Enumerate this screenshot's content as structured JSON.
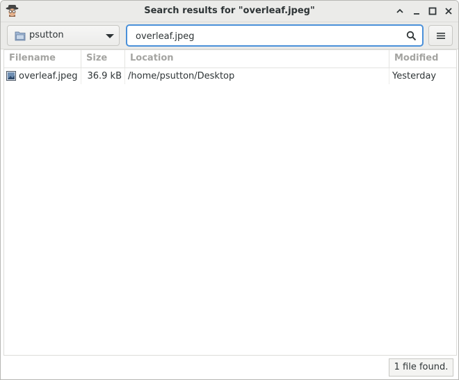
{
  "window": {
    "title": "Search results for \"overleaf.jpeg\""
  },
  "toolbar": {
    "folder_label": "psutton",
    "search_value": "overleaf.jpeg",
    "search_placeholder": ""
  },
  "table": {
    "columns": [
      "Filename",
      "Size",
      "Location",
      "Modified"
    ],
    "rows": [
      {
        "filename": "overleaf.jpeg",
        "size": "36.9 kB",
        "location": "/home/psutton/Desktop",
        "modified": "Yesterday"
      }
    ]
  },
  "status": {
    "text": "1 file found."
  },
  "colors": {
    "focus_border": "#4a90d9",
    "header_text": "#a4a4a1",
    "titlebar_bg": "#ebebe9"
  }
}
